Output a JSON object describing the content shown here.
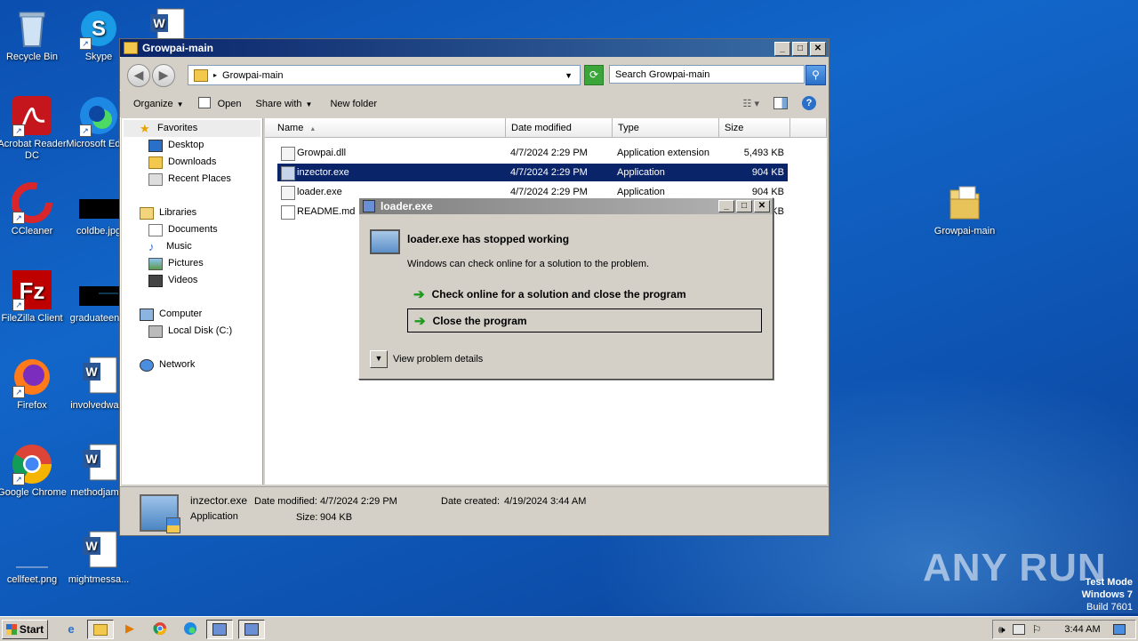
{
  "desktop": {
    "icons": [
      {
        "label": "Recycle Bin"
      },
      {
        "label": "Skype"
      },
      {
        "label": "Acrobat Reader DC"
      },
      {
        "label": "Microsoft Edge"
      },
      {
        "label": "CCleaner"
      },
      {
        "label": "coldbe.jpg"
      },
      {
        "label": "FileZilla Client"
      },
      {
        "label": "graduateen..."
      },
      {
        "label": "Firefox"
      },
      {
        "label": "involvedwa..."
      },
      {
        "label": "Google Chrome"
      },
      {
        "label": "methodjam..."
      },
      {
        "label": "cellfeet.png"
      },
      {
        "label": "mightmessa..."
      },
      {
        "label": "Growpai-main"
      }
    ],
    "watermark": "ANY RUN",
    "test_mode": {
      "line1": "Test Mode",
      "line2": "Windows 7",
      "line3": "Build 7601"
    }
  },
  "explorer": {
    "title": "Growpai-main",
    "address": "Growpai-main",
    "search_placeholder": "Search Growpai-main",
    "toolbar": {
      "organize": "Organize",
      "open": "Open",
      "share": "Share with",
      "new_folder": "New folder"
    },
    "nav": {
      "favorites": "Favorites",
      "desktop": "Desktop",
      "downloads": "Downloads",
      "recent": "Recent Places",
      "libraries": "Libraries",
      "documents": "Documents",
      "music": "Music",
      "pictures": "Pictures",
      "videos": "Videos",
      "computer": "Computer",
      "local_disk": "Local Disk (C:)",
      "network": "Network"
    },
    "columns": {
      "name": "Name",
      "date": "Date modified",
      "type": "Type",
      "size": "Size"
    },
    "files": [
      {
        "name": "Growpai.dll",
        "date": "4/7/2024 2:29 PM",
        "type": "Application extension",
        "size": "5,493 KB"
      },
      {
        "name": "inzector.exe",
        "date": "4/7/2024 2:29 PM",
        "type": "Application",
        "size": "904 KB"
      },
      {
        "name": "loader.exe",
        "date": "4/7/2024 2:29 PM",
        "type": "Application",
        "size": "904 KB"
      },
      {
        "name": "README.md",
        "date": "",
        "type": "",
        "size": "KB"
      }
    ],
    "details": {
      "name": "inzector.exe",
      "type": "Application",
      "date_modified_label": "Date modified:",
      "date_modified": "4/7/2024 2:29 PM",
      "size_label": "Size:",
      "size": "904 KB",
      "date_created_label": "Date created:",
      "date_created": "4/19/2024 3:44 AM"
    }
  },
  "dialog": {
    "title": "loader.exe",
    "heading": "loader.exe has stopped working",
    "message": "Windows can check online for a solution to the problem.",
    "option1": "Check online for a solution and close the program",
    "option2": "Close the program",
    "details": "View problem details"
  },
  "taskbar": {
    "start": "Start",
    "clock": "3:44 AM"
  }
}
